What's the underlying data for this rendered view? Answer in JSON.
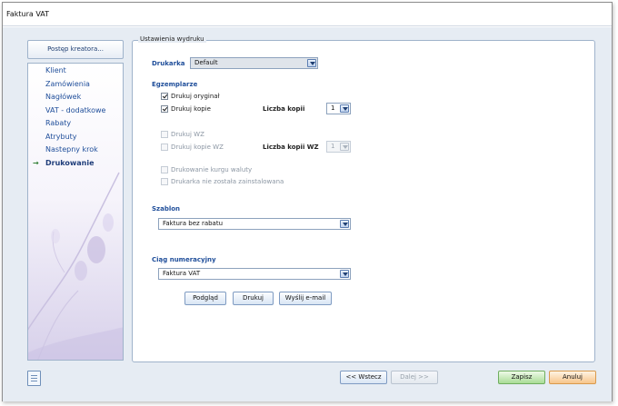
{
  "window": {
    "title": "Faktura VAT"
  },
  "sidebar": {
    "header_button": "Postęp kreatora...",
    "active_marker": "→",
    "items": [
      {
        "label": "Klient"
      },
      {
        "label": "Zamówienia"
      },
      {
        "label": "Nagłówek"
      },
      {
        "label": "VAT - dodatkowe"
      },
      {
        "label": "Rabaty"
      },
      {
        "label": "Atrybuty"
      },
      {
        "label": "Nastepny krok"
      },
      {
        "label": "Drukowanie",
        "active": true
      }
    ]
  },
  "print_settings": {
    "legend": "Ustawienia wydruku",
    "printer_label": "Drukarka",
    "printer_value": "Default",
    "copies_section": "Egzemplarze",
    "print_original": {
      "label": "Drukuj oryginał",
      "checked": true
    },
    "print_copies": {
      "label": "Drukuj kopie",
      "checked": true
    },
    "copies_count_label": "Liczba kopii",
    "copies_count_value": "1",
    "print_wz": {
      "label": "Drukuj WZ",
      "checked": false,
      "enabled": false
    },
    "print_wz_copies": {
      "label": "Drukuj kopie WZ",
      "checked": false,
      "enabled": false
    },
    "wz_copies_count_label": "Liczba kopii WZ",
    "wz_copies_count_value": "1",
    "print_exchange_rate": {
      "label": "Drukowanie kurgu waluty",
      "checked": false,
      "enabled": false
    },
    "printer_not_installed": {
      "label": "Drukarka nie została zainstalowana",
      "checked": false,
      "enabled": false
    },
    "template_section": "Szablon",
    "template_value": "Faktura bez rabatu",
    "numbering_section": "Ciąg numeracyjny",
    "numbering_value": "Faktura VAT",
    "preview_button": "Podgląd",
    "print_button": "Drukuj",
    "email_button": "Wyślij e-mail"
  },
  "footer": {
    "back_button": "<< Wstecz",
    "next_button": "Dalej >>",
    "save_button": "Zapisz",
    "cancel_button": "Anuluj"
  },
  "colors": {
    "accent": "#1f4e9a",
    "save_green": "#a9dc95",
    "cancel_orange": "#f7c58a"
  }
}
